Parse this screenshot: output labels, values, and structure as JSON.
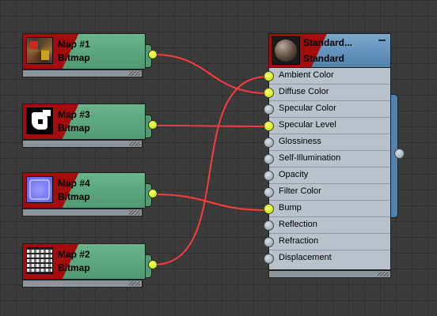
{
  "map_nodes": [
    {
      "name": "Map #1",
      "type": "Bitmap",
      "thumbnail": "texture-thumbnail-1"
    },
    {
      "name": "Map #3",
      "type": "Bitmap",
      "thumbnail": "texture-thumbnail-3"
    },
    {
      "name": "Map #4",
      "type": "Bitmap",
      "thumbnail": "texture-thumbnail-4"
    },
    {
      "name": "Map #2",
      "type": "Bitmap",
      "thumbnail": "texture-thumbnail-2"
    }
  ],
  "material_node": {
    "name": "Standard...",
    "type": "Standard",
    "thumbnail": "material-sphere-thumbnail",
    "slots": [
      {
        "label": "Ambient Color",
        "connected": true
      },
      {
        "label": "Diffuse Color",
        "connected": true
      },
      {
        "label": "Specular Color",
        "connected": false
      },
      {
        "label": "Specular Level",
        "connected": true
      },
      {
        "label": "Glossiness",
        "connected": false
      },
      {
        "label": "Self-Illumination",
        "connected": false
      },
      {
        "label": "Opacity",
        "connected": false
      },
      {
        "label": "Filter Color",
        "connected": false
      },
      {
        "label": "Bump",
        "connected": true
      },
      {
        "label": "Reflection",
        "connected": false
      },
      {
        "label": "Refraction",
        "connected": false
      },
      {
        "label": "Displacement",
        "connected": false
      }
    ]
  },
  "connections": [
    {
      "from": "Map #1",
      "to": "Diffuse Color"
    },
    {
      "from": "Map #3",
      "to": "Specular Level"
    },
    {
      "from": "Map #4",
      "to": "Bump"
    },
    {
      "from": "Map #2",
      "to": "Ambient Color"
    }
  ],
  "colors": {
    "canvas_bg": "#3b3b3b",
    "map_node": "#5fa882",
    "material_node": "#5f8fb8",
    "node_title_band": "#a50d0d",
    "wire": "#ff3a3a",
    "socket_connected": "#d4ec00",
    "socket_empty": "#aab4be"
  }
}
